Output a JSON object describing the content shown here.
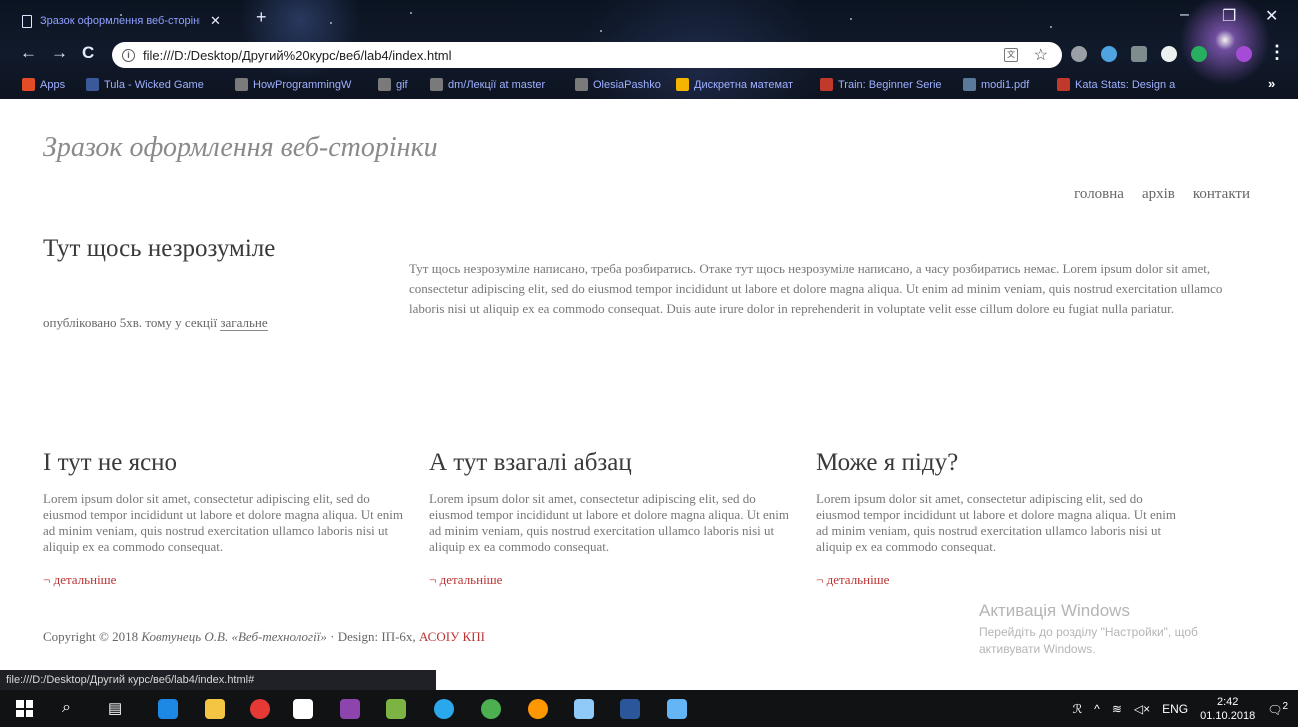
{
  "browser": {
    "tab_title": "Зразок оформлення веб-сторінки",
    "url": "file:///D:/Desktop/Другий%20курс/веб/lab4/index.html",
    "bookmarks": [
      {
        "label": "Apps",
        "color": "#e34c26"
      },
      {
        "label": "Tula - Wicked Game",
        "color": "#3b5998"
      },
      {
        "label": "HowProgrammingW",
        "color": "#7a7a7a"
      },
      {
        "label": "gif",
        "color": "#7a7a7a"
      },
      {
        "label": "dm/Лекції at master",
        "color": "#7a7a7a"
      },
      {
        "label": "OlesiaPashko",
        "color": "#7a7a7a"
      },
      {
        "label": "Дискретна математ",
        "color": "#f4b400"
      },
      {
        "label": "Train: Beginner Serie",
        "color": "#c0392b"
      },
      {
        "label": "modi1.pdf",
        "color": "#5b7a9a"
      },
      {
        "label": "Kata Stats: Design a",
        "color": "#c0392b"
      }
    ]
  },
  "page": {
    "site_title": "Зразок оформлення веб-сторінки",
    "nav": [
      "головна",
      "архів",
      "контакти"
    ],
    "intro": {
      "heading": "Тут щось незрозуміле",
      "meta_prefix": "опубліковано 5хв. тому у секції",
      "meta_section": "загальне",
      "text": "Тут щось незрозуміле написано, треба розбиратись. Отаке тут щось незрозуміле написано, а часу розбиратись немає. Lorem ipsum dolor sit amet, consectetur adipiscing elit, sed do eiusmod tempor incididunt ut labore et dolore magna aliqua. Ut enim ad minim veniam, quis nostrud exercitation ullamco laboris nisi ut aliquip ex ea commodo consequat. Duis aute irure dolor in reprehenderit in voluptate velit esse cillum dolore eu fugiat nulla pariatur."
    },
    "columns": [
      {
        "heading": "І тут не ясно",
        "text": "Lorem ipsum dolor sit amet, consectetur adipiscing elit, sed do eiusmod tempor incididunt ut labore et dolore magna aliqua. Ut enim ad minim veniam, quis nostrud exercitation ullamco laboris nisi ut aliquip ex ea commodo consequat.",
        "more": "¬ детальніше"
      },
      {
        "heading": "А тут взагалі абзац",
        "text": "Lorem ipsum dolor sit amet, consectetur adipiscing elit, sed do eiusmod tempor incididunt ut labore et dolore magna aliqua. Ut enim ad minim veniam, quis nostrud exercitation ullamco laboris nisi ut aliquip ex ea commodo consequat.",
        "more": "¬ детальніше"
      },
      {
        "heading": "Може я піду?",
        "text": "Lorem ipsum dolor sit amet, consectetur adipiscing elit, sed do eiusmod tempor incididunt ut labore et dolore magna aliqua. Ut enim ad minim veniam, quis nostrud exercitation ullamco laboris nisi ut aliquip ex ea commodo consequat.",
        "more": "¬ детальніше"
      }
    ],
    "footer": {
      "prefix": "Copyright © 2018",
      "author": "Ковтунець О.В. «Веб-технології»",
      "design": "· Design: ІП-6х,",
      "org": "АСОІУ КПІ"
    }
  },
  "status_url": "file:///D:/Desktop/Другий курс/веб/lab4/index.html#",
  "windows_activation": {
    "title": "Активація Windows",
    "subtitle": "Перейдіть до розділу \"Настройки\", щоб активувати Windows."
  },
  "taskbar": {
    "language": "ENG",
    "time": "2:42",
    "date": "01.10.2018",
    "notification_count": "2",
    "apps": [
      {
        "icon": "edge-icon",
        "color": "#1e88e5"
      },
      {
        "icon": "file-explorer-icon",
        "color": "#f4c542"
      },
      {
        "icon": "chrome-icon",
        "color": "#e53935"
      },
      {
        "icon": "store-icon",
        "color": "#ffffff"
      },
      {
        "icon": "visual-studio-icon",
        "color": "#8e44ad"
      },
      {
        "icon": "notepad-icon",
        "color": "#7cb342"
      },
      {
        "icon": "telegram-icon",
        "color": "#29a9eb"
      },
      {
        "icon": "utorrent-icon",
        "color": "#4caf50"
      },
      {
        "icon": "rainbow-app-icon",
        "color": "#ff9800"
      },
      {
        "icon": "paint-icon",
        "color": "#90caf9"
      },
      {
        "icon": "word-icon",
        "color": "#2b579a"
      },
      {
        "icon": "app-icon",
        "color": "#64b5f6"
      }
    ]
  }
}
